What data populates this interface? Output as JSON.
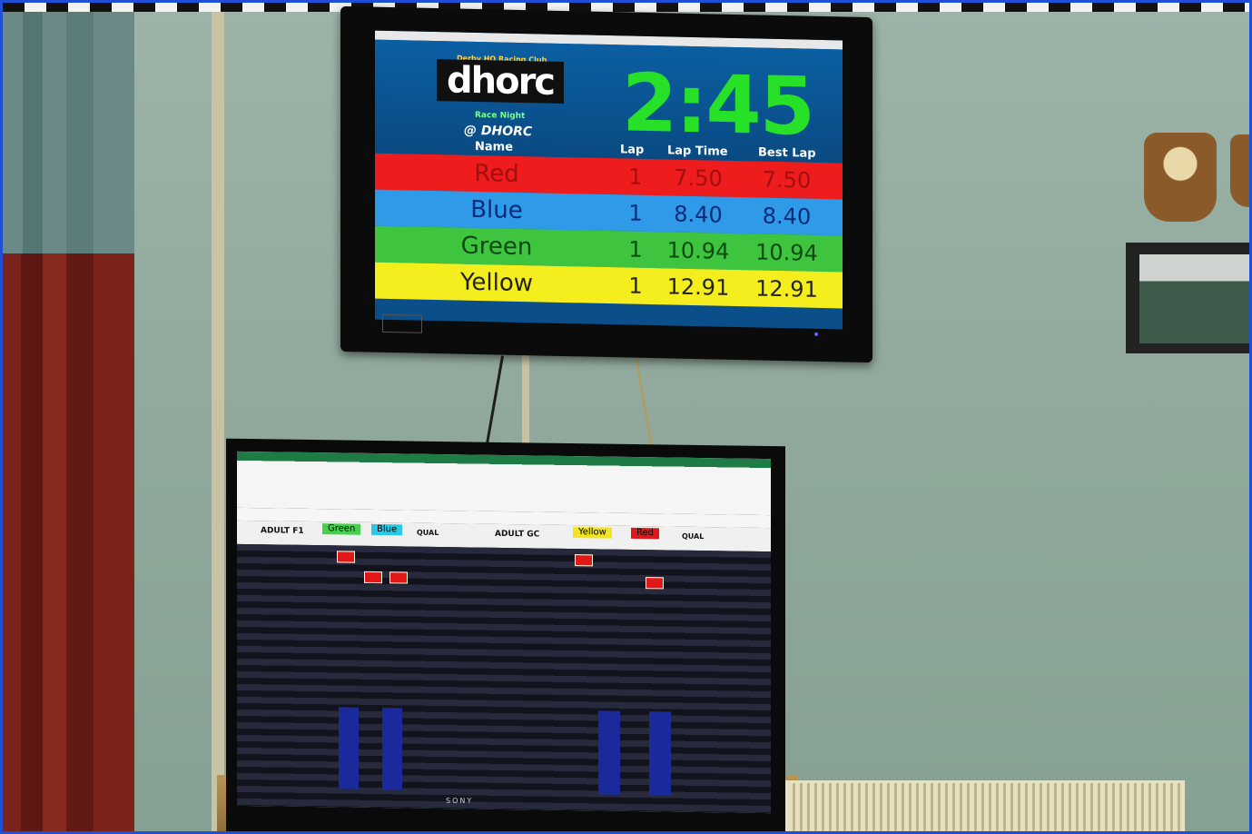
{
  "scoreboard": {
    "logo_text": "dhorc",
    "logo_small": "Derby HO Racing Club",
    "subtitle": "Race Night",
    "venue": "@ DHORC",
    "timer": "2:45",
    "columns": {
      "name": "Name",
      "lap": "Lap",
      "lap_time": "Lap Time",
      "best_lap": "Best Lap"
    },
    "rows": [
      {
        "name": "Red",
        "lap": "1",
        "lap_time": "7.50",
        "best_lap": "7.50",
        "bg": "#ee1c1c",
        "fg": "#a01010"
      },
      {
        "name": "Blue",
        "lap": "1",
        "lap_time": "8.40",
        "best_lap": "8.40",
        "bg": "#2e9ae8",
        "fg": "#0b2a7a"
      },
      {
        "name": "Green",
        "lap": "1",
        "lap_time": "10.94",
        "best_lap": "10.94",
        "bg": "#3ec43e",
        "fg": "#0d4a12"
      },
      {
        "name": "Yellow",
        "lap": "1",
        "lap_time": "12.91",
        "best_lap": "12.91",
        "bg": "#f4ee1e",
        "fg": "#222222"
      }
    ]
  },
  "monitor": {
    "brand": "SONY",
    "left_sheet": {
      "class_label": "ADULT F1",
      "lane_a": "Green",
      "lane_b": "Blue",
      "qual": "QUAL",
      "lane_a_color": "#44d24a",
      "lane_b_color": "#27c9e6"
    },
    "right_sheet": {
      "class_label": "ADULT GC",
      "lane_a": "Yellow",
      "lane_b": "Red",
      "qual": "QUAL",
      "lane_a_color": "#f2e41e",
      "lane_b_color": "#e01818"
    }
  }
}
